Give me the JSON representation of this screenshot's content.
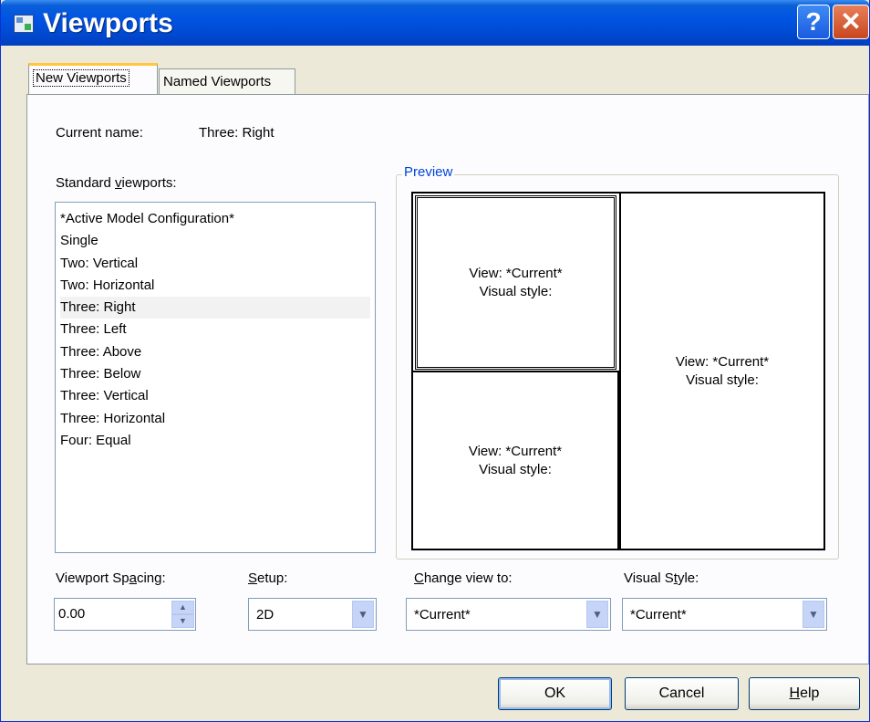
{
  "window": {
    "title": "Viewports",
    "help_glyph": "?",
    "close_glyph": "✕"
  },
  "tabs": [
    {
      "label": "New Viewports",
      "active": true
    },
    {
      "label": "Named Viewports",
      "active": false
    }
  ],
  "current_name": {
    "label": "Current name:",
    "value": "Three: Right"
  },
  "standard_viewports": {
    "label_pre": "Standard ",
    "label_mnemonic": "v",
    "label_post": "iewports:",
    "items": [
      "*Active Model Configuration*",
      "Single",
      "Two:  Vertical",
      "Two:  Horizontal",
      "Three: Right",
      "Three: Left",
      "Three: Above",
      "Three: Below",
      "Three: Vertical",
      "Three: Horizontal",
      "Four:  Equal"
    ],
    "selected": "Three: Right"
  },
  "preview": {
    "caption": "Preview",
    "viewports": [
      {
        "view": "View: *Current*",
        "style": "Visual style:"
      },
      {
        "view": "View: *Current*",
        "style": "Visual style:"
      },
      {
        "view": "View: *Current*",
        "style": "Visual style:"
      }
    ]
  },
  "viewport_spacing": {
    "label_pre": "Viewport Sp",
    "label_mnemonic": "a",
    "label_post": "cing:",
    "value": "0.00"
  },
  "setup": {
    "label_mnemonic": "S",
    "label_post": "etup:",
    "value": "2D"
  },
  "change_view_to": {
    "label_mnemonic": "C",
    "label_post": "hange view to:",
    "value": "*Current*"
  },
  "visual_style": {
    "label_pre": "Visual S",
    "label_mnemonic": "t",
    "label_post": "yle:",
    "value": "*Current*"
  },
  "buttons": {
    "ok": "OK",
    "cancel": "Cancel",
    "help_mnemonic": "H",
    "help_post": "elp"
  },
  "colors": {
    "titlebar": "#0054e3",
    "dialog_bg": "#ece9d8",
    "group_caption": "#0046d5",
    "tab_highlight": "#ffc83c"
  }
}
